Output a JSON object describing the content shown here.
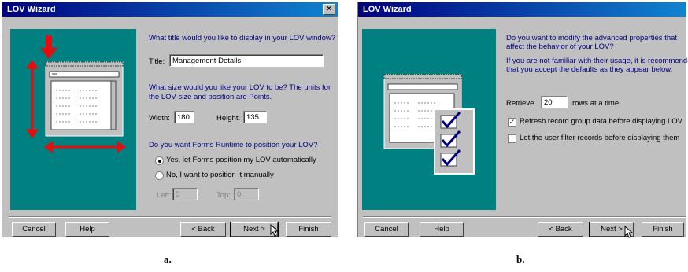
{
  "window_a": {
    "title": "LOV Wizard",
    "close_glyph": "×",
    "q_title": "What title would you like to display in your LOV window?",
    "title_label": "Title:",
    "title_value": "Management Details",
    "q_size_1": "What size would you like your LOV to be? The units for",
    "q_size_2": "the LOV size and position are Points.",
    "width_label": "Width:",
    "width_value": "180",
    "height_label": "Height:",
    "height_value": "135",
    "q_position": "Do you want Forms Runtime to position your LOV?",
    "radio_yes": "Yes, let Forms position my LOV automatically",
    "radio_no": "No, I want to position it manually",
    "left_label": "Left:",
    "left_value": "0",
    "top_label": "Top:",
    "top_value": "0",
    "buttons": {
      "cancel": "Cancel",
      "help": "Help",
      "back": "< Back",
      "next": "Next >",
      "finish": "Finish"
    }
  },
  "window_b": {
    "title": "LOV Wizard",
    "q_advanced_1": "Do you want to modify the advanced properties that",
    "q_advanced_2": "affect the behavior of your LOV?",
    "info_1": "If you are not familiar with their usage, it is recommended",
    "info_2": "that you accept the defaults as they appear below.",
    "retrieve_label": "Retrieve",
    "retrieve_value": "20",
    "retrieve_suffix": "rows at a time.",
    "check_refresh": "Refresh record group data before displaying LOV",
    "check_filter": "Let the user filter records before displaying them",
    "buttons": {
      "cancel": "Cancel",
      "help": "Help",
      "back": "< Back",
      "next": "Next >",
      "finish": "Finish"
    }
  },
  "captions": {
    "a": "a.",
    "b": "b."
  },
  "colors": {
    "panel": "#008080",
    "dialog": "#c0c0c0",
    "title_bar": "#000080",
    "arrow": "#e01010",
    "label_text": "#000080"
  }
}
